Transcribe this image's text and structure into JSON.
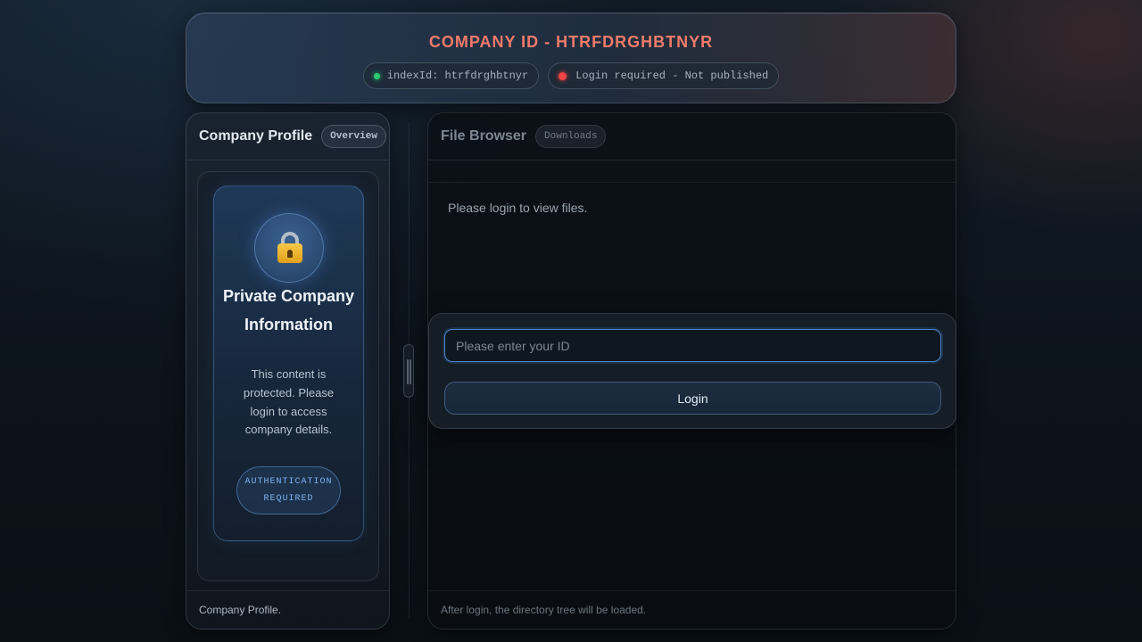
{
  "header": {
    "title": "COMPANY ID - HTRFDRGHBTNYR",
    "index_chip": "indexId: htrfdrghbtnyr",
    "status_chip": "Login required - Not published",
    "colors": {
      "title": "#f07a6a",
      "ok_dot": "#2ecc71",
      "error_dot": "#ef4444"
    }
  },
  "profile_panel": {
    "title": "Company Profile",
    "tag": "Overview",
    "card": {
      "icon": "lock-icon",
      "title": "Private Company Information",
      "text": "This content is protected. Please login to access company details.",
      "badge": "AUTHENTICATION REQUIRED"
    },
    "footer": "Company Profile."
  },
  "file_panel": {
    "title": "File Browser",
    "tag": "Downloads",
    "message": "Please login to view files.",
    "footer": "After login, the directory tree will be loaded."
  },
  "login": {
    "id_placeholder": "Please enter your ID",
    "id_value": "",
    "button_label": "Login"
  }
}
